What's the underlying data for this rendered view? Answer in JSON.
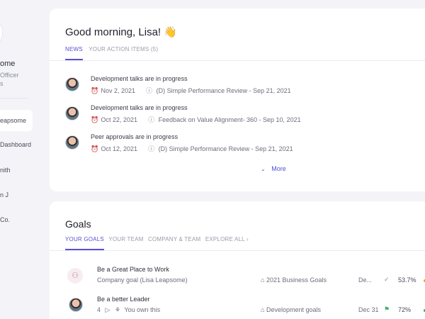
{
  "sidebar": {
    "name_fragment": "ome",
    "role_line1": "Officer",
    "role_line2": "s",
    "items": [
      {
        "label": "eapsome",
        "active": true
      },
      {
        "label": "Dashboard"
      },
      {
        "label": "nith"
      },
      {
        "label": "n J"
      },
      {
        "label": "Co."
      }
    ]
  },
  "news_card": {
    "greeting": "Good morning, Lisa!",
    "wave": "👋",
    "tabs": [
      {
        "label": "NEWS",
        "active": true
      },
      {
        "label": "YOUR ACTION ITEMS (5)"
      }
    ],
    "items": [
      {
        "title": "Development talks are in progress",
        "date": "Nov 2, 2021",
        "source": "(D) Simple Performance Review - Sep 21, 2021"
      },
      {
        "title": "Development talks are in progress",
        "date": "Oct 22, 2021",
        "source": "Feedback on Value Alignment- 360 - Sep 10, 2021"
      },
      {
        "title": "Peer approvals are in progress",
        "date": "Oct 12, 2021",
        "source": "(D) Simple Performance Review - Sep 21, 2021"
      }
    ],
    "more_label": "More",
    "icons": {
      "clock": "alarm-clock-icon",
      "info": "info-icon",
      "more": "chevron-down-icon"
    }
  },
  "goals_card": {
    "title": "Goals",
    "tabs": [
      {
        "label": "YOUR GOALS",
        "active": true
      },
      {
        "label": "YOUR TEAM"
      },
      {
        "label": "COMPANY & TEAM"
      },
      {
        "label": "EXPLORE ALL"
      }
    ],
    "rows": [
      {
        "title": "Be a Great Place to Work",
        "subtitle": "Company goal (Lisa Leapsome)",
        "tag": "2021 Business Goals",
        "due": "De...",
        "status_icon": "check-icon",
        "progress": "53.7%",
        "dot_color": "#e0a040"
      },
      {
        "title": "Be a better Leader",
        "count": "4",
        "subtitle": "You own this",
        "tag": "Development goals",
        "due": "Dec 31",
        "status_icon": "flag-icon",
        "progress": "72%",
        "dot_color": "#3aa86b"
      }
    ]
  },
  "colors": {
    "accent": "#5a4fd6",
    "link": "#4a50d8",
    "background": "#f4f4f8"
  }
}
